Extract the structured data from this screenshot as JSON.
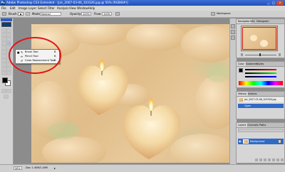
{
  "window": {
    "app_icon": "Ps",
    "title": "Adobe Photoshop CS3 Extended - [pic_2007-03-06_103326.jpg @ 50% (RGB/8#)]",
    "minimize": "_",
    "maximize": "□",
    "close": "×"
  },
  "menu": {
    "items": [
      "File",
      "Edit",
      "Image",
      "Layer",
      "Select",
      "Filter",
      "Analysis",
      "View",
      "Window",
      "Help"
    ]
  },
  "options": {
    "brush_label": "Brush:",
    "mode_label": "Mode:",
    "mode_value": "Normal",
    "opacity_label": "Opacity:",
    "opacity_value": "100%",
    "flow_label": "Flow:",
    "flow_value": "100%",
    "workspace_label": "Workspace"
  },
  "flyout": {
    "items": [
      {
        "label": "Brush Tool",
        "shortcut": "B",
        "selected": true
      },
      {
        "label": "Pencil Tool",
        "shortcut": "B",
        "selected": false
      },
      {
        "label": "Color Replacement Tool",
        "shortcut": "B",
        "selected": false
      }
    ]
  },
  "status": {
    "zoom": "50%",
    "doc": "Doc: 1.40M/1.40M"
  },
  "panels": {
    "navigator": {
      "tabs": [
        "Navigator",
        "Info",
        "Histogram"
      ]
    },
    "color": {
      "tabs": [
        "Color",
        "Swatches",
        "Styles"
      ]
    },
    "history": {
      "tabs": [
        "History",
        "Actions"
      ],
      "items": [
        "pic_2007-03-06_103326.jpg",
        "Open"
      ]
    },
    "layers": {
      "tabs": [
        "Layers",
        "Channels",
        "Paths"
      ],
      "layer_name": "Background"
    }
  },
  "colors": {
    "accent_blue": "#2255c4",
    "highlight": "#316ac5",
    "annotation_red": "#e01616"
  }
}
